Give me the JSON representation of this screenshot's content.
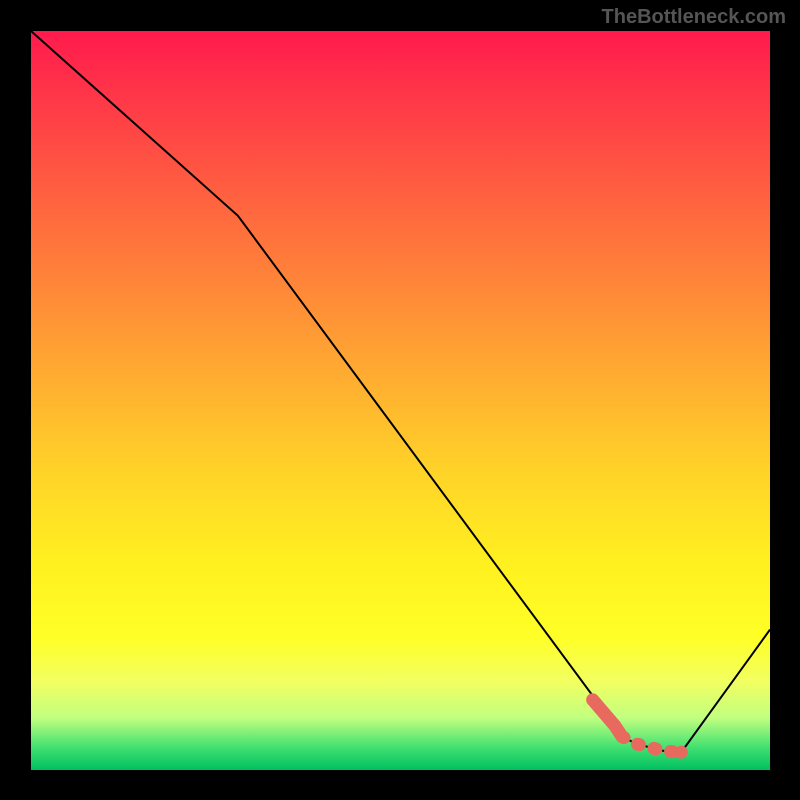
{
  "attribution": "TheBottleneck.com",
  "chart_data": {
    "type": "line",
    "title": "",
    "xlabel": "",
    "ylabel": "",
    "xlim": [
      0,
      100
    ],
    "ylim": [
      0,
      100
    ],
    "series": [
      {
        "name": "bottleneck-curve",
        "x": [
          0,
          28,
          79,
          80,
          82,
          84,
          85.5,
          86.5,
          88,
          100
        ],
        "values": [
          100,
          75,
          6,
          4.5,
          3.5,
          3.0,
          2.6,
          2.5,
          2.4,
          19
        ]
      },
      {
        "name": "highlight-segment",
        "x": [
          76,
          79,
          80,
          82,
          84,
          85.5,
          86.5,
          88
        ],
        "values": [
          9.5,
          6,
          4.5,
          3.5,
          3.0,
          2.6,
          2.5,
          2.4
        ]
      }
    ],
    "highlight_style": "thick-coral-dotted-then-solid"
  }
}
